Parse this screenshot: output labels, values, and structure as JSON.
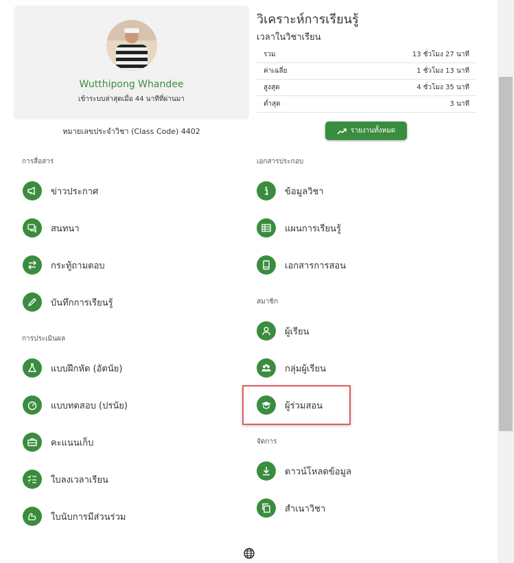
{
  "profile": {
    "name": "Wutthipong Whandee",
    "last_login": "เข้าระบบล่าสุดเมื่อ 44 นาทีที่ผ่านมา",
    "class_code": "หมายเลขประจำวิชา (Class Code) 4402"
  },
  "analytics": {
    "title": "วิเคราะห์การเรียนรู้",
    "subtitle": "เวลาในวิชาเรียน",
    "stats": [
      {
        "label": "รวม",
        "value": "13 ชั่วโมง 27 นาที"
      },
      {
        "label": "ค่าเฉลี่ย",
        "value": "1 ชั่วโมง 13 นาที"
      },
      {
        "label": "สูงสุด",
        "value": "4 ชั่วโมง 35 นาที"
      },
      {
        "label": "ต่ำสุด",
        "value": "3 นาที"
      }
    ],
    "report_button": "รายงานทั้งหมด"
  },
  "sections": {
    "communication": "การสื่อสาร",
    "assessment": "การประเมินผล",
    "documents": "เอกสารประกอบ",
    "members": "สมาชิก",
    "manage": "จัดการ"
  },
  "menu": {
    "announcements": "ข่าวประกาศ",
    "chat": "สนทนา",
    "qa": "กระทู้ถามตอบ",
    "learning_log": "บันทึกการเรียนรู้",
    "exercise": "แบบฝึกหัด (อัตนัย)",
    "quiz": "แบบทดสอบ (ปรนัย)",
    "scores": "คะแนนเก็บ",
    "attendance": "ใบลงเวลาเรียน",
    "participation": "ใบนับการมีส่วนร่วม",
    "course_info": "ข้อมูลวิชา",
    "lesson_plan": "แผนการเรียนรู้",
    "teaching_docs": "เอกสารการสอน",
    "students": "ผู้เรียน",
    "student_groups": "กลุ่มผู้เรียน",
    "co_teachers": "ผู้ร่วมสอน",
    "download": "ดาวน์โหลดข้อมูล",
    "copy_course": "สำเนาวิชา"
  },
  "colors": {
    "accent": "#3a8d3e",
    "highlight": "#e05d5d"
  }
}
